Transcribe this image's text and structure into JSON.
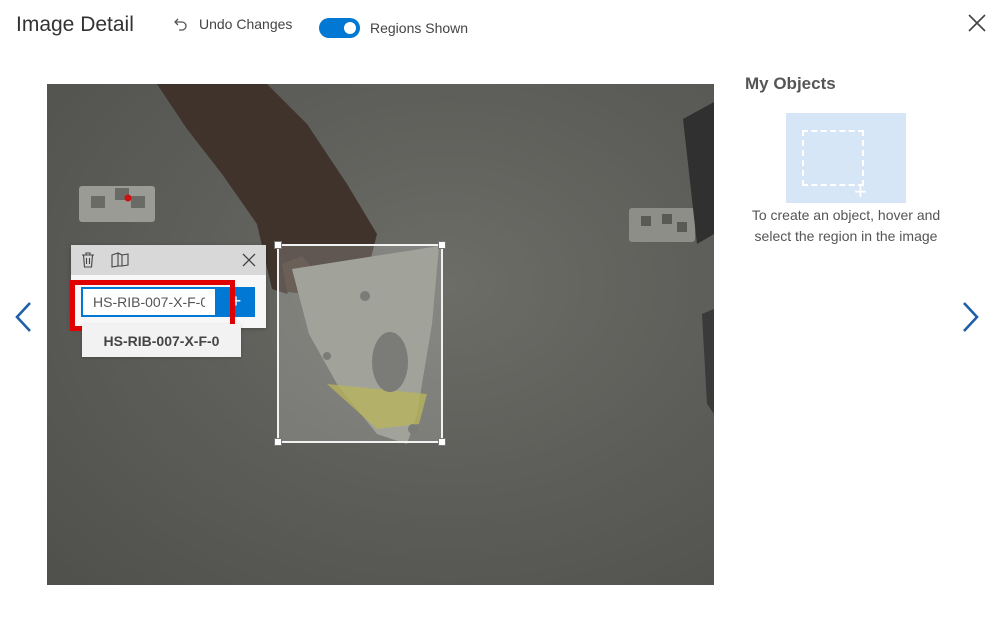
{
  "header": {
    "title": "Image Detail",
    "undo_label": "Undo Changes",
    "toggle_label": "Regions Shown",
    "toggle_on": true
  },
  "tag_editor": {
    "input_value": "HS-RIB-007-X-F-0",
    "add_label": "+",
    "suggestion": "HS-RIB-007-X-F-0"
  },
  "panel": {
    "title": "My Objects",
    "hint": "To create an object, hover and select the region in the image"
  },
  "icons": {
    "undo": "undo-icon",
    "close": "close-icon",
    "trash": "trash-icon",
    "copy": "copy-icon",
    "prev": "chevron-left-icon",
    "next": "chevron-right-icon"
  },
  "colors": {
    "accent": "#0078d4",
    "highlight": "#e00000",
    "object_thumb": "#d6e6f6"
  }
}
